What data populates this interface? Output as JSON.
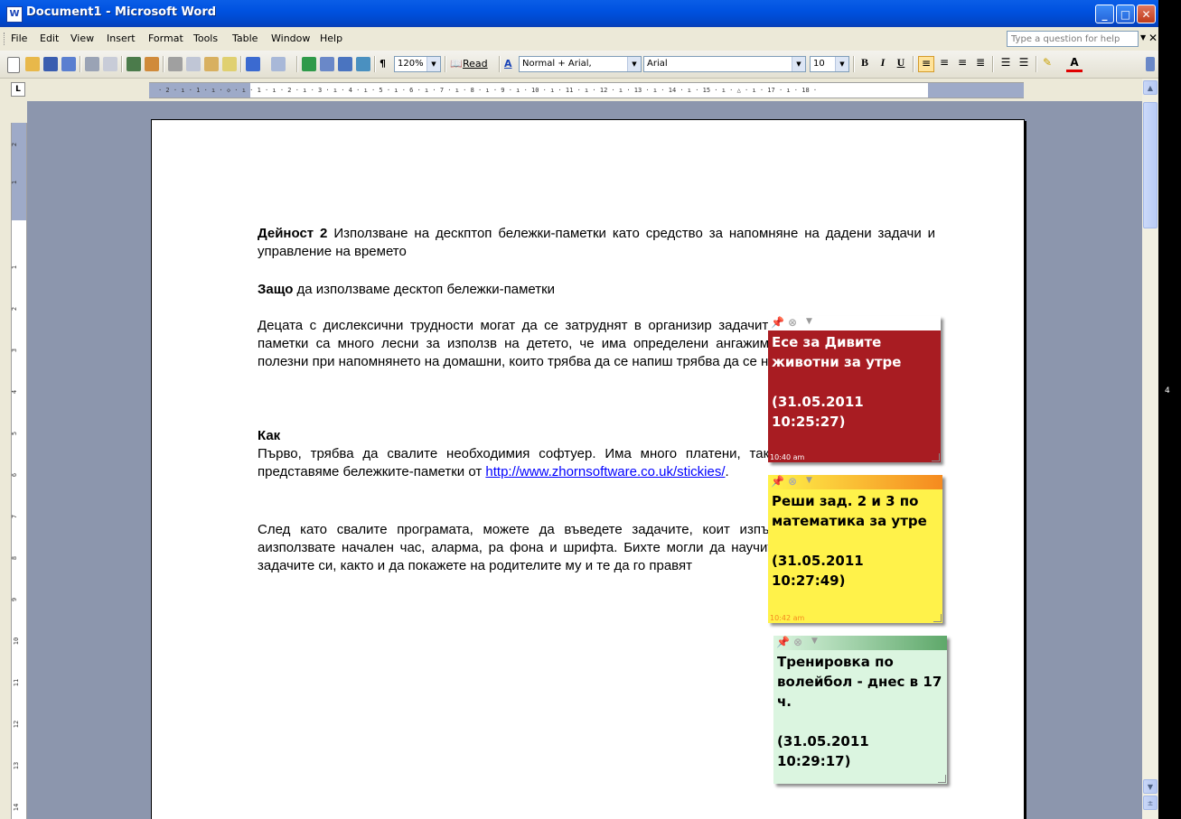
{
  "window": {
    "title": "Document1 - Microsoft Word",
    "app_icon": "word-doc-icon"
  },
  "menubar": {
    "items": [
      "File",
      "Edit",
      "View",
      "Insert",
      "Format",
      "Tools",
      "Table",
      "Window",
      "Help"
    ],
    "help_placeholder": "Type a question for help"
  },
  "toolbar": {
    "zoom": "120%",
    "read_label": "Read",
    "style": "Normal + Arial,",
    "font": "Arial",
    "size": "10",
    "pilcrow": "¶",
    "bold": "B",
    "italic": "I",
    "underline": "U"
  },
  "ruler": {
    "h_ticks": "· 2 · ı · 1 · ı · ◇ · ı · 1 · ı · 2 · ı · 3 · ı · 4 · ı · 5 · ı · 6 · ı · 7 · ı · 8 · ı · 9 · ı · 10 · ı · 11 · ı · 12 · ı · 13 · ı · 14 · ı · 15 · ı · △ · ı · 17 · ı · 18 ·",
    "v_ticks": [
      "2",
      "1",
      "1",
      "2",
      "3",
      "4",
      "5",
      "6",
      "7",
      "8",
      "9",
      "10",
      "11",
      "12",
      "13",
      "14"
    ]
  },
  "document": {
    "p1_bold": "Дейност 2",
    "p1_text": " Използване на дескптоп бележки-паметки като средство за напомняне на дадени задачи и управление на времето",
    "p2_bold": "Защо",
    "p2_text": " да използваме десктоп бележки-паметки",
    "p3_text": "Децата с дислексични трудности могат да се затруднят в организир задачите си. Десктоп бележките-паметки са много лесни за използв на детето, че има определени ангажименти за деня. Бележките полезни при напомнянето на домашни, които трябва да се напиш трябва да се научат.",
    "p4_heading": "Как",
    "p4_text": "Първо, трябва да свалите необходимия софтуер. Има много платени, така и безплатни – тук ви представяме бележките-паметки от ",
    "p4_link": "http://www.zhornsoftware.co.uk/stickies/",
    "p4_end": ".",
    "p5_text": "След като свалите програмата, можете да въведете задачите, коит изпълни за деня. Можете д аизползвате начален час, аларма, ра фона и шрифта. Бихте могли да научите самото дете как да въ задачите си, както и да покажете на родителите му и те да го правят"
  },
  "notes": [
    {
      "text": "Есе за Дивите животни за утре\n\n(31.05.2011 10:25:27)",
      "time": "10:40 am",
      "bg": "#a81c22",
      "fg": "#ffffff",
      "bar": "#ffffff"
    },
    {
      "text": "Реши зад. 2 и 3 по математика за утре\n\n(31.05.2011 10:27:49)",
      "time": "10:42 am",
      "bg": "#fff24a",
      "fg": "#000000",
      "bar": "#f58a1f"
    },
    {
      "text": "Тренировка по волейбол - днес в 17 ч.\n\n(31.05.2011 10:29:17)",
      "time": "",
      "bg": "#dbf5e0",
      "fg": "#000000",
      "bar": "#5ea86a"
    }
  ],
  "side_text": "4"
}
